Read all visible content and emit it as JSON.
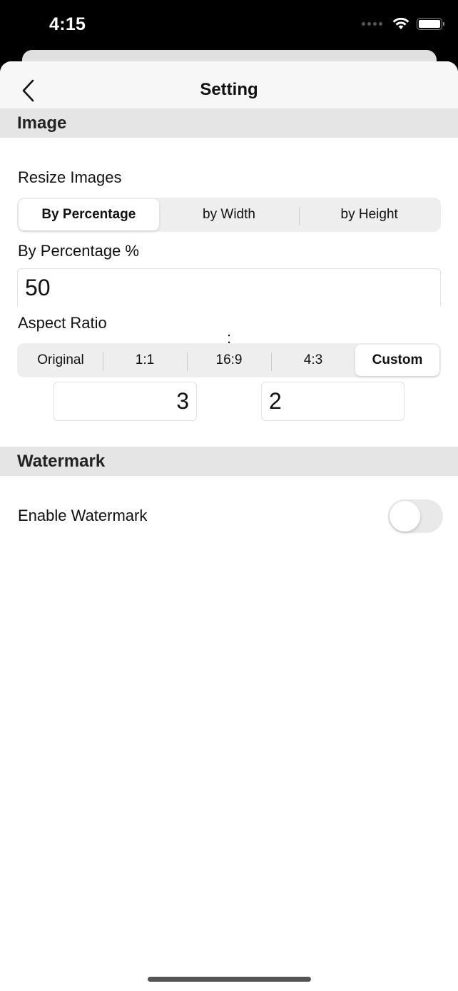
{
  "status_bar": {
    "time": "4:15",
    "icons": [
      "cellular-signal-icon",
      "wifi-icon",
      "battery-icon"
    ]
  },
  "nav": {
    "title": "Setting",
    "back_icon": "chevron-left-icon"
  },
  "sections": {
    "image": {
      "header": "Image",
      "resize": {
        "label": "Resize Images",
        "options": [
          "By Percentage",
          "by Width",
          "by Height"
        ],
        "selected": "By Percentage"
      },
      "percentage": {
        "label": "By Percentage %",
        "value": "50"
      },
      "aspect_ratio": {
        "label": "Aspect Ratio",
        "options": [
          "Original",
          "1:1",
          "16:9",
          "4:3",
          "Custom"
        ],
        "selected": "Custom",
        "custom_width": "3",
        "separator": ":",
        "custom_height": "2"
      }
    },
    "watermark": {
      "header": "Watermark",
      "enable": {
        "label": "Enable Watermark",
        "enabled": false
      }
    }
  }
}
